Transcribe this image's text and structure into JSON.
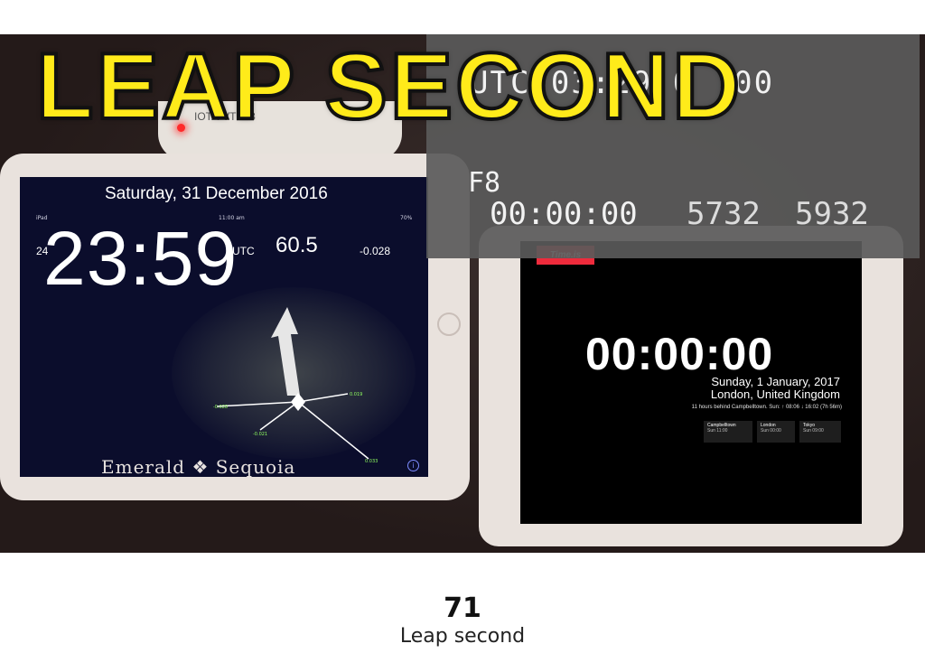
{
  "headline": "LEAP SECOND",
  "overlay": {
    "top_code": "UTC 03:29 0 :00",
    "frame_label": "F8",
    "timecode": "00:00:00",
    "count_1": "5732",
    "count_2": "5932"
  },
  "timer_device": {
    "brand": "IOTA-VTI V3"
  },
  "emerald_clock": {
    "status_left": "iPad",
    "status_center": "11:00 am",
    "status_right": "70%",
    "date": "Saturday, 31 December 2016",
    "hour_format": "24",
    "timezone": "UTC",
    "offset": "-0.028",
    "time": "23:59",
    "seconds": "60.5",
    "dial_labels": [
      "-0.028",
      "0.019",
      "-0.021",
      "0.033"
    ],
    "brand": "Emerald ❖ Sequoia",
    "info_icon": "info-icon"
  },
  "timeis": {
    "logo": "Time.is",
    "time": "00:00:00",
    "date": "Sunday, 1 January, 2017",
    "location": "London, United Kingdom",
    "info": "11 hours behind Campbelltown. Sun: ↑ 08:06 ↓ 16:02 (7h 56m)",
    "cities": [
      {
        "name": "Campbelltown",
        "time": "Sun 11:00"
      },
      {
        "name": "London",
        "time": "Sun 00:00"
      },
      {
        "name": "Tokyo",
        "time": "Sun 09:00"
      }
    ]
  },
  "slide": {
    "number": "71",
    "caption": "Leap second"
  },
  "colors": {
    "headline": "#ffeb1a",
    "timeis_red": "#ef2b3c",
    "led": "#ff2a2a"
  }
}
